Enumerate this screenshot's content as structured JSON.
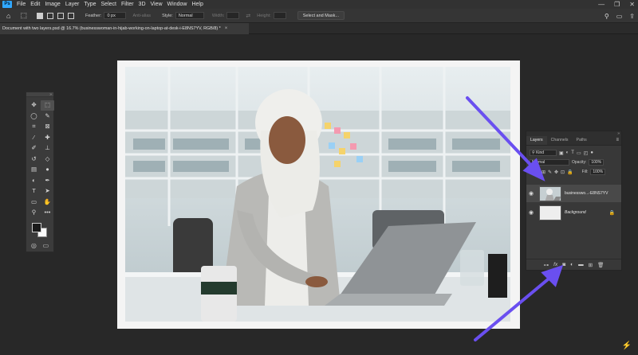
{
  "app": {
    "logo_text": "Ps"
  },
  "menu": [
    "File",
    "Edit",
    "Image",
    "Layer",
    "Type",
    "Select",
    "Filter",
    "3D",
    "View",
    "Window",
    "Help"
  ],
  "window_controls": {
    "minimize": "—",
    "restore": "❐",
    "close": "✕"
  },
  "options_bar": {
    "feather_label": "Feather:",
    "feather_value": "0 px",
    "antialias_label": "Anti-alias",
    "style_label": "Style:",
    "style_value": "Normal",
    "width_label": "Width:",
    "height_label": "Height:",
    "select_mask_button": "Select and Mask..."
  },
  "document_tab": {
    "title": "Document with two layers.psd @ 16.7% (businesswoman-in-hijab-working-on-laptop-at-desk-i-E8NS7YV, RGB/8) *",
    "close": "×"
  },
  "toolbar": {
    "grip": "»",
    "tools": [
      {
        "name": "move-tool",
        "glyph": "✥"
      },
      {
        "name": "marquee-tool",
        "glyph": "⬚"
      },
      {
        "name": "lasso-tool",
        "glyph": "◯"
      },
      {
        "name": "quick-select-tool",
        "glyph": "✎"
      },
      {
        "name": "crop-tool",
        "glyph": "⌗"
      },
      {
        "name": "frame-tool",
        "glyph": "⊠"
      },
      {
        "name": "eyedropper-tool",
        "glyph": "⁄"
      },
      {
        "name": "healing-tool",
        "glyph": "✚"
      },
      {
        "name": "brush-tool",
        "glyph": "✐"
      },
      {
        "name": "stamp-tool",
        "glyph": "⊥"
      },
      {
        "name": "history-brush-tool",
        "glyph": "↺"
      },
      {
        "name": "eraser-tool",
        "glyph": "◇"
      },
      {
        "name": "gradient-tool",
        "glyph": "▤"
      },
      {
        "name": "blur-tool",
        "glyph": "●"
      },
      {
        "name": "dodge-tool",
        "glyph": "◐"
      },
      {
        "name": "pen-tool",
        "glyph": "✒"
      },
      {
        "name": "type-tool",
        "glyph": "T"
      },
      {
        "name": "path-select-tool",
        "glyph": "➤"
      },
      {
        "name": "shape-tool",
        "glyph": "▭"
      },
      {
        "name": "hand-tool",
        "glyph": "✋"
      },
      {
        "name": "zoom-tool",
        "glyph": "⚲"
      },
      {
        "name": "more-tools",
        "glyph": "•••"
      }
    ]
  },
  "layers_panel": {
    "grip": "»",
    "tabs": [
      "Layers",
      "Channels",
      "Paths"
    ],
    "menu": "≡",
    "filter_value": "Kind",
    "blend_value": "Normal",
    "opacity_label": "Opacity:",
    "opacity_value": "100%",
    "lock_label": "Lock:",
    "fill_label": "Fill:",
    "fill_value": "100%",
    "layers": [
      {
        "name": "businesswo...-E8NS7YV",
        "selected": true
      },
      {
        "name": "Background",
        "selected": false,
        "locked": true
      }
    ],
    "footer_icons": [
      "link-icon",
      "fx-icon",
      "mask-icon",
      "adjustment-icon",
      "group-icon",
      "new-layer-icon",
      "trash-icon"
    ]
  },
  "colors": {
    "app_bg": "#282828",
    "annotation_arrow": "#6a4ff0",
    "brand": "#35c26a"
  }
}
